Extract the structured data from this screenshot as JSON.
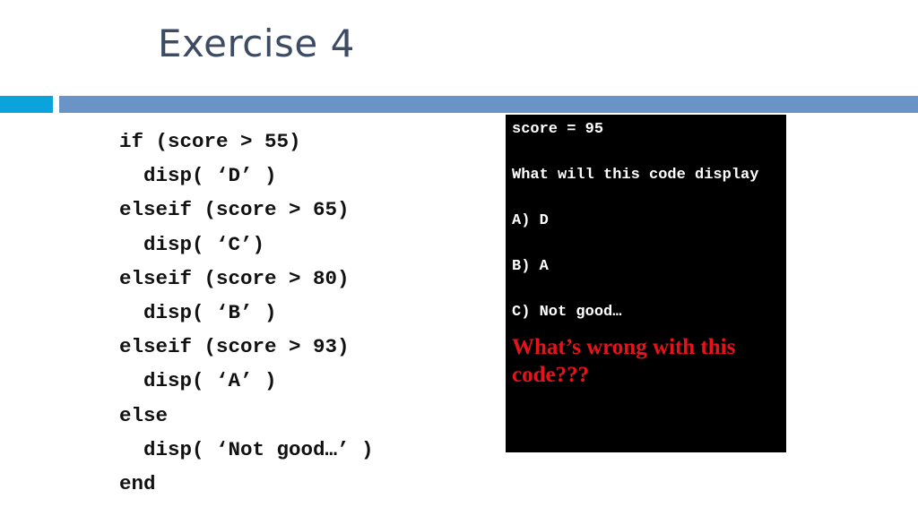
{
  "slide": {
    "title": "Exercise 4",
    "colors": {
      "title": "#3d4b63",
      "accent_bar_left": "#0aa3dc",
      "accent_bar_right": "#6a93c7",
      "question_highlight": "#e5131b"
    }
  },
  "code": {
    "lines": [
      {
        "text": "if (score > 55)",
        "indent": false
      },
      {
        "text": "disp( ‘D’ )",
        "indent": true
      },
      {
        "text": "elseif (score > 65)",
        "indent": false
      },
      {
        "text": "disp( ‘C’)",
        "indent": true
      },
      {
        "text": "elseif (score > 80)",
        "indent": false
      },
      {
        "text": "disp( ‘B’ )",
        "indent": true
      },
      {
        "text": "elseif (score > 93)",
        "indent": false
      },
      {
        "text": "disp( ‘A’ )",
        "indent": true
      },
      {
        "text": "else",
        "indent": false
      },
      {
        "text": "disp( ‘Not good…’ )",
        "indent": true
      },
      {
        "text": "end",
        "indent": false
      }
    ]
  },
  "question_box": {
    "given": "score = 95",
    "prompt": "What will this code display",
    "options": [
      {
        "label": "A)",
        "text": "D"
      },
      {
        "label": "B)",
        "text": "A"
      },
      {
        "label": "C)",
        "text": "Not good…"
      }
    ],
    "follow_up": "What’s wrong with this code???"
  }
}
